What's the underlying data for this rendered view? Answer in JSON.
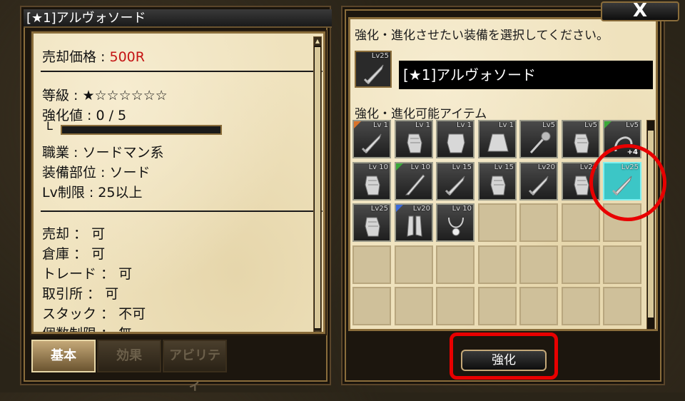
{
  "left": {
    "title": "[★1]アルヴォソード",
    "sell_price_label": "売却価格 : ",
    "sell_price_value": "500R",
    "grade": "等級 : ★☆☆☆☆☆☆",
    "enhance": "強化値 : 0 / 5",
    "enhance_progress": 0,
    "enhance_connector": "L",
    "job": "職業 : ソードマン系",
    "slot": "装備部位 : ソード",
    "lv_limit": "Lv制限 : 25以上",
    "sell": "売却 ： 可",
    "storage": "倉庫 ： 可",
    "trade": "トレード ： 可",
    "exchange": "取引所 ： 可",
    "stack": "スタック ： 不可",
    "count_limit": "個数制限 ： 無",
    "tabs": [
      "基本",
      "効果",
      "アビリティ"
    ]
  },
  "right": {
    "close_label": "X",
    "instruction": "強化・進化させたい装備を選択してください。",
    "selected_level": "Lv25",
    "selected_name": "[★1]アルヴォソード",
    "list_label": "強化・進化可能アイテム",
    "enhance_button": "強化",
    "items": [
      {
        "lv": "Lv 1",
        "icon": "sword-icon",
        "corner": "#d9732a",
        "plus": ""
      },
      {
        "lv": "Lv 1",
        "icon": "gauntlet-icon",
        "corner": "",
        "plus": ""
      },
      {
        "lv": "Lv 1",
        "icon": "armor-icon",
        "corner": "",
        "plus": ""
      },
      {
        "lv": "Lv 1",
        "icon": "skirt-icon",
        "corner": "",
        "plus": ""
      },
      {
        "lv": "Lv5",
        "icon": "mace-icon",
        "corner": "",
        "plus": ""
      },
      {
        "lv": "Lv5",
        "icon": "gauntlet-icon",
        "corner": "",
        "plus": ""
      },
      {
        "lv": "Lv5",
        "icon": "whip-icon",
        "corner": "#3aa838",
        "plus": "+4"
      },
      {
        "lv": "Lv 10",
        "icon": "gauntlet-icon",
        "corner": "",
        "plus": ""
      },
      {
        "lv": "Lv 10",
        "icon": "blade-icon",
        "corner": "#3aa838",
        "plus": ""
      },
      {
        "lv": "Lv 15",
        "icon": "sword-icon",
        "corner": "",
        "plus": ""
      },
      {
        "lv": "Lv 15",
        "icon": "gauntlet-icon",
        "corner": "",
        "plus": ""
      },
      {
        "lv": "Lv20",
        "icon": "sword-icon",
        "corner": "",
        "plus": ""
      },
      {
        "lv": "Lv20",
        "icon": "gauntlet-icon",
        "corner": "",
        "plus": ""
      },
      {
        "lv": "Lv25",
        "icon": "sword-icon",
        "corner": "",
        "plus": "",
        "highlight": true
      },
      {
        "lv": "Lv25",
        "icon": "gauntlet-icon",
        "corner": "",
        "plus": ""
      },
      {
        "lv": "Lv20",
        "icon": "greaves-icon",
        "corner": "#3a6ad9",
        "plus": ""
      },
      {
        "lv": "Lv 10",
        "icon": "necklace-icon",
        "corner": "",
        "plus": ""
      }
    ]
  }
}
